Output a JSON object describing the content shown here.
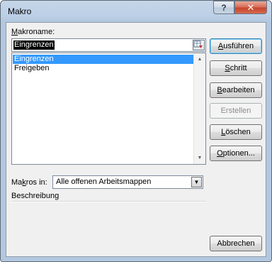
{
  "window": {
    "title": "Makro"
  },
  "titlebar": {
    "help_glyph": "?",
    "close_glyph": "✕"
  },
  "form": {
    "name_label_key": "M",
    "name_label_rest": "akroname:",
    "name_value": "Eingrenzen",
    "macros": [
      "Eingrenzen",
      "Freigeben"
    ],
    "selected_index": 0,
    "in_label_pre": "Ma",
    "in_label_key": "k",
    "in_label_post": "ros in:",
    "in_value": "Alle offenen Arbeitsmappen",
    "desc_label": "Beschreibung"
  },
  "buttons": {
    "run": {
      "key": "A",
      "rest": "usführen"
    },
    "step": {
      "pre": "",
      "key": "S",
      "rest": "chritt"
    },
    "edit": {
      "pre": "",
      "key": "B",
      "rest": "earbeiten"
    },
    "create": {
      "label": "Erstellen"
    },
    "delete": {
      "pre": "",
      "key": "L",
      "rest": "öschen"
    },
    "options": {
      "pre": "",
      "key": "O",
      "rest": "ptionen..."
    },
    "cancel": {
      "label": "Abbrechen"
    }
  }
}
